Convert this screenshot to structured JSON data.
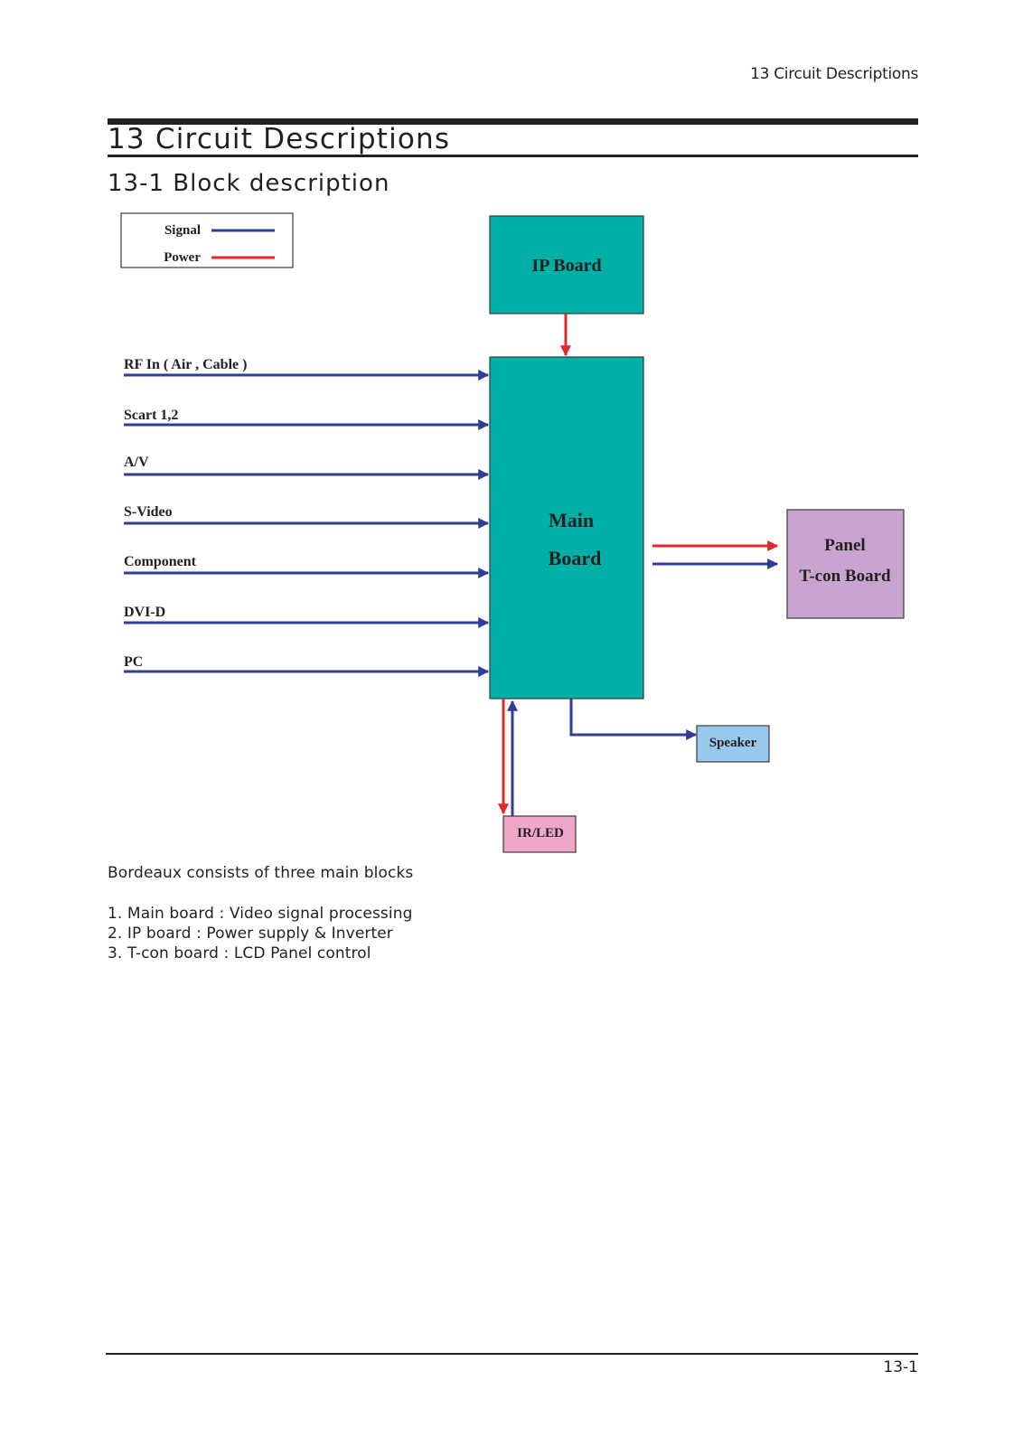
{
  "header": {
    "running_title": "13 Circuit Descriptions"
  },
  "chapter": {
    "title": "13 Circuit Descriptions",
    "section_title": "13-1 Block description"
  },
  "legend": {
    "items": [
      {
        "label": "Signal",
        "type": "signal"
      },
      {
        "label": "Power",
        "type": "power"
      }
    ]
  },
  "colors": {
    "signal": "#2e3d98",
    "power": "#e3262b",
    "board_teal": "#00afa5",
    "panel_purple": "#caa4d1",
    "speaker_blue": "#98c8ec",
    "irled_pink": "#eea7c8",
    "box_border": "#3a3a3a"
  },
  "blocks": {
    "ip_board": "IP Board",
    "main_board": [
      "Main",
      "Board"
    ],
    "panel": [
      "Panel",
      "T-con Board"
    ],
    "speaker": "Speaker",
    "ir_led": "IR/LED"
  },
  "inputs": [
    "RF In ( Air , Cable )",
    "Scart 1,2",
    "A/V",
    "S-Video",
    "Component",
    "DVI-D",
    "PC"
  ],
  "connections": [
    {
      "from": "IP Board",
      "to": "Main Board",
      "type": "power"
    },
    {
      "from": "Main Board",
      "to": "Panel T-con Board",
      "type": "power"
    },
    {
      "from": "Main Board",
      "to": "Panel T-con Board",
      "type": "signal"
    },
    {
      "from": "Main Board",
      "to": "Speaker",
      "type": "signal"
    },
    {
      "from": "Main Board",
      "to": "IR/LED",
      "type": "power"
    },
    {
      "from": "IR/LED",
      "to": "Main Board",
      "type": "signal"
    }
  ],
  "description": {
    "intro": "Bordeaux consists of three main blocks",
    "items": [
      "1. Main board : Video signal processing",
      "2. IP  board : Power supply & Inverter",
      "3. T-con board : LCD Panel control"
    ]
  },
  "footer": {
    "page_number": "13-1"
  }
}
